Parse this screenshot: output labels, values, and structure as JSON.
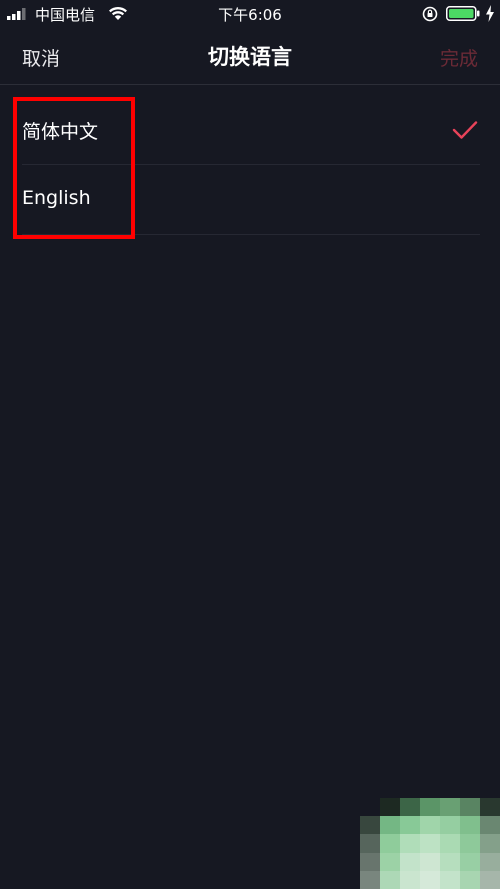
{
  "status_bar": {
    "carrier": "中国电信",
    "time": "下午6:06"
  },
  "nav": {
    "cancel_label": "取消",
    "title": "切换语言",
    "done_label": "完成"
  },
  "languages": [
    {
      "label": "简体中文",
      "selected": true
    },
    {
      "label": "English",
      "selected": false
    }
  ],
  "colors": {
    "background": "#161822",
    "accent": "#e8435a",
    "done_disabled": "#6b2a36",
    "highlight_box": "#ff0000"
  }
}
